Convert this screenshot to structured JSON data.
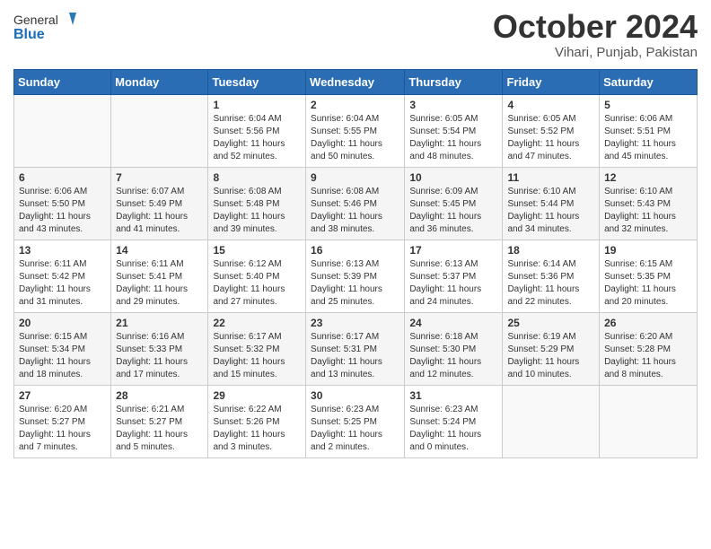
{
  "header": {
    "logo_general": "General",
    "logo_blue": "Blue",
    "month": "October 2024",
    "location": "Vihari, Punjab, Pakistan"
  },
  "days_of_week": [
    "Sunday",
    "Monday",
    "Tuesday",
    "Wednesday",
    "Thursday",
    "Friday",
    "Saturday"
  ],
  "weeks": [
    [
      {
        "day": "",
        "info": ""
      },
      {
        "day": "",
        "info": ""
      },
      {
        "day": "1",
        "info": "Sunrise: 6:04 AM\nSunset: 5:56 PM\nDaylight: 11 hours and 52 minutes."
      },
      {
        "day": "2",
        "info": "Sunrise: 6:04 AM\nSunset: 5:55 PM\nDaylight: 11 hours and 50 minutes."
      },
      {
        "day": "3",
        "info": "Sunrise: 6:05 AM\nSunset: 5:54 PM\nDaylight: 11 hours and 48 minutes."
      },
      {
        "day": "4",
        "info": "Sunrise: 6:05 AM\nSunset: 5:52 PM\nDaylight: 11 hours and 47 minutes."
      },
      {
        "day": "5",
        "info": "Sunrise: 6:06 AM\nSunset: 5:51 PM\nDaylight: 11 hours and 45 minutes."
      }
    ],
    [
      {
        "day": "6",
        "info": "Sunrise: 6:06 AM\nSunset: 5:50 PM\nDaylight: 11 hours and 43 minutes."
      },
      {
        "day": "7",
        "info": "Sunrise: 6:07 AM\nSunset: 5:49 PM\nDaylight: 11 hours and 41 minutes."
      },
      {
        "day": "8",
        "info": "Sunrise: 6:08 AM\nSunset: 5:48 PM\nDaylight: 11 hours and 39 minutes."
      },
      {
        "day": "9",
        "info": "Sunrise: 6:08 AM\nSunset: 5:46 PM\nDaylight: 11 hours and 38 minutes."
      },
      {
        "day": "10",
        "info": "Sunrise: 6:09 AM\nSunset: 5:45 PM\nDaylight: 11 hours and 36 minutes."
      },
      {
        "day": "11",
        "info": "Sunrise: 6:10 AM\nSunset: 5:44 PM\nDaylight: 11 hours and 34 minutes."
      },
      {
        "day": "12",
        "info": "Sunrise: 6:10 AM\nSunset: 5:43 PM\nDaylight: 11 hours and 32 minutes."
      }
    ],
    [
      {
        "day": "13",
        "info": "Sunrise: 6:11 AM\nSunset: 5:42 PM\nDaylight: 11 hours and 31 minutes."
      },
      {
        "day": "14",
        "info": "Sunrise: 6:11 AM\nSunset: 5:41 PM\nDaylight: 11 hours and 29 minutes."
      },
      {
        "day": "15",
        "info": "Sunrise: 6:12 AM\nSunset: 5:40 PM\nDaylight: 11 hours and 27 minutes."
      },
      {
        "day": "16",
        "info": "Sunrise: 6:13 AM\nSunset: 5:39 PM\nDaylight: 11 hours and 25 minutes."
      },
      {
        "day": "17",
        "info": "Sunrise: 6:13 AM\nSunset: 5:37 PM\nDaylight: 11 hours and 24 minutes."
      },
      {
        "day": "18",
        "info": "Sunrise: 6:14 AM\nSunset: 5:36 PM\nDaylight: 11 hours and 22 minutes."
      },
      {
        "day": "19",
        "info": "Sunrise: 6:15 AM\nSunset: 5:35 PM\nDaylight: 11 hours and 20 minutes."
      }
    ],
    [
      {
        "day": "20",
        "info": "Sunrise: 6:15 AM\nSunset: 5:34 PM\nDaylight: 11 hours and 18 minutes."
      },
      {
        "day": "21",
        "info": "Sunrise: 6:16 AM\nSunset: 5:33 PM\nDaylight: 11 hours and 17 minutes."
      },
      {
        "day": "22",
        "info": "Sunrise: 6:17 AM\nSunset: 5:32 PM\nDaylight: 11 hours and 15 minutes."
      },
      {
        "day": "23",
        "info": "Sunrise: 6:17 AM\nSunset: 5:31 PM\nDaylight: 11 hours and 13 minutes."
      },
      {
        "day": "24",
        "info": "Sunrise: 6:18 AM\nSunset: 5:30 PM\nDaylight: 11 hours and 12 minutes."
      },
      {
        "day": "25",
        "info": "Sunrise: 6:19 AM\nSunset: 5:29 PM\nDaylight: 11 hours and 10 minutes."
      },
      {
        "day": "26",
        "info": "Sunrise: 6:20 AM\nSunset: 5:28 PM\nDaylight: 11 hours and 8 minutes."
      }
    ],
    [
      {
        "day": "27",
        "info": "Sunrise: 6:20 AM\nSunset: 5:27 PM\nDaylight: 11 hours and 7 minutes."
      },
      {
        "day": "28",
        "info": "Sunrise: 6:21 AM\nSunset: 5:27 PM\nDaylight: 11 hours and 5 minutes."
      },
      {
        "day": "29",
        "info": "Sunrise: 6:22 AM\nSunset: 5:26 PM\nDaylight: 11 hours and 3 minutes."
      },
      {
        "day": "30",
        "info": "Sunrise: 6:23 AM\nSunset: 5:25 PM\nDaylight: 11 hours and 2 minutes."
      },
      {
        "day": "31",
        "info": "Sunrise: 6:23 AM\nSunset: 5:24 PM\nDaylight: 11 hours and 0 minutes."
      },
      {
        "day": "",
        "info": ""
      },
      {
        "day": "",
        "info": ""
      }
    ]
  ]
}
